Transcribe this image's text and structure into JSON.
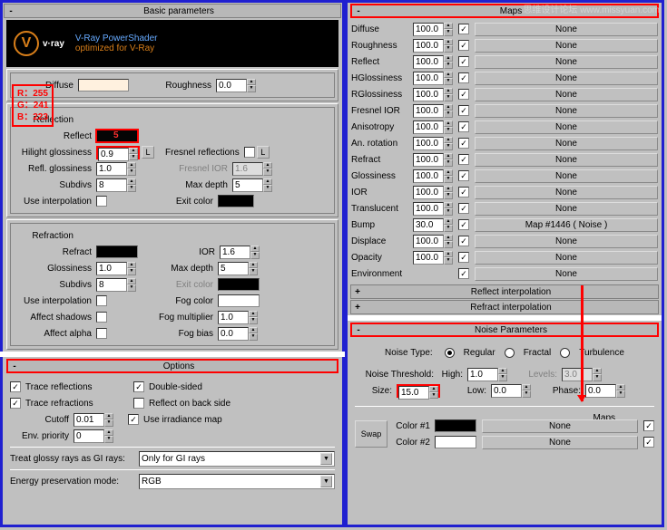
{
  "watermark": "思维设计论坛 www.missyuan.com",
  "rgb_overlay": {
    "r": "R：255",
    "g": "G：241",
    "b": "B：223"
  },
  "basic": {
    "title": "Basic parameters",
    "vray_title": "V-Ray PowerShader",
    "vray_sub": "optimized for V-Ray",
    "vray_brand": "v·ray",
    "diffuse_lbl": "Diffuse",
    "roughness_lbl": "Roughness",
    "roughness_val": "0.0",
    "reflection_lbl": "Reflection",
    "reflect_lbl": "Reflect",
    "reflect_val": "5",
    "hilight_lbl": "Hilight glossiness",
    "hilight_val": "0.9",
    "L": "L",
    "fresnel_refl_lbl": "Fresnel reflections",
    "refl_gloss_lbl": "Refl. glossiness",
    "refl_gloss_val": "1.0",
    "fresnel_ior_lbl": "Fresnel IOR",
    "fresnel_ior_val": "1.6",
    "subdivs_lbl": "Subdivs",
    "subdivs_val": "8",
    "max_depth_lbl": "Max depth",
    "max_depth_val": "5",
    "use_interp_lbl": "Use interpolation",
    "exit_color_lbl": "Exit color",
    "refraction_lbl": "Refraction",
    "refract_lbl": "Refract",
    "ior_lbl": "IOR",
    "ior_val": "1.6",
    "glossiness_lbl": "Glossiness",
    "glossiness_val": "1.0",
    "max_depth2_val": "5",
    "subdivs2_val": "8",
    "fog_color_lbl": "Fog color",
    "affect_shadows_lbl": "Affect shadows",
    "fog_mult_lbl": "Fog multiplier",
    "fog_mult_val": "1.0",
    "affect_alpha_lbl": "Affect alpha",
    "fog_bias_lbl": "Fog bias",
    "fog_bias_val": "0.0"
  },
  "options": {
    "title": "Options",
    "trace_refl": "Trace reflections",
    "double_sided": "Double-sided",
    "trace_refr": "Trace refractions",
    "reflect_back": "Reflect on back side",
    "cutoff_lbl": "Cutoff",
    "cutoff_val": "0.01",
    "use_irrad": "Use irradiance map",
    "env_priority_lbl": "Env. priority",
    "env_priority_val": "0",
    "glossy_lbl": "Treat glossy rays as GI rays:",
    "glossy_val": "Only for GI rays",
    "energy_lbl": "Energy preservation mode:",
    "energy_val": "RGB"
  },
  "maps": {
    "title": "Maps",
    "none": "None",
    "rows": [
      {
        "lbl": "Diffuse",
        "val": "100.0"
      },
      {
        "lbl": "Roughness",
        "val": "100.0"
      },
      {
        "lbl": "Reflect",
        "val": "100.0"
      },
      {
        "lbl": "HGlossiness",
        "val": "100.0"
      },
      {
        "lbl": "RGlossiness",
        "val": "100.0"
      },
      {
        "lbl": "Fresnel IOR",
        "val": "100.0"
      },
      {
        "lbl": "Anisotropy",
        "val": "100.0"
      },
      {
        "lbl": "An. rotation",
        "val": "100.0"
      },
      {
        "lbl": "Refract",
        "val": "100.0"
      },
      {
        "lbl": "Glossiness",
        "val": "100.0"
      },
      {
        "lbl": "IOR",
        "val": "100.0"
      },
      {
        "lbl": "Translucent",
        "val": "100.0"
      },
      {
        "lbl": "Bump",
        "val": "30.0"
      },
      {
        "lbl": "Displace",
        "val": "100.0"
      },
      {
        "lbl": "Opacity",
        "val": "100.0"
      },
      {
        "lbl": "Environment",
        "val": ""
      }
    ],
    "bump_map": "Map #1446  ( Noise )",
    "reflect_interp": "Reflect interpolation",
    "refract_interp": "Refract interpolation"
  },
  "noise": {
    "title": "Noise Parameters",
    "type_lbl": "Noise Type:",
    "regular": "Regular",
    "fractal": "Fractal",
    "turbulence": "Turbulence",
    "thresh_lbl": "Noise Threshold:",
    "high_lbl": "High:",
    "high_val": "1.0",
    "levels_lbl": "Levels:",
    "levels_val": "3.0",
    "size_lbl": "Size:",
    "size_val": "15.0",
    "low_lbl": "Low:",
    "low_val": "0.0",
    "phase_lbl": "Phase:",
    "phase_val": "0.0",
    "swap": "Swap",
    "color1_lbl": "Color #1",
    "color2_lbl": "Color #2",
    "maps_lbl": "Maps",
    "none": "None"
  }
}
